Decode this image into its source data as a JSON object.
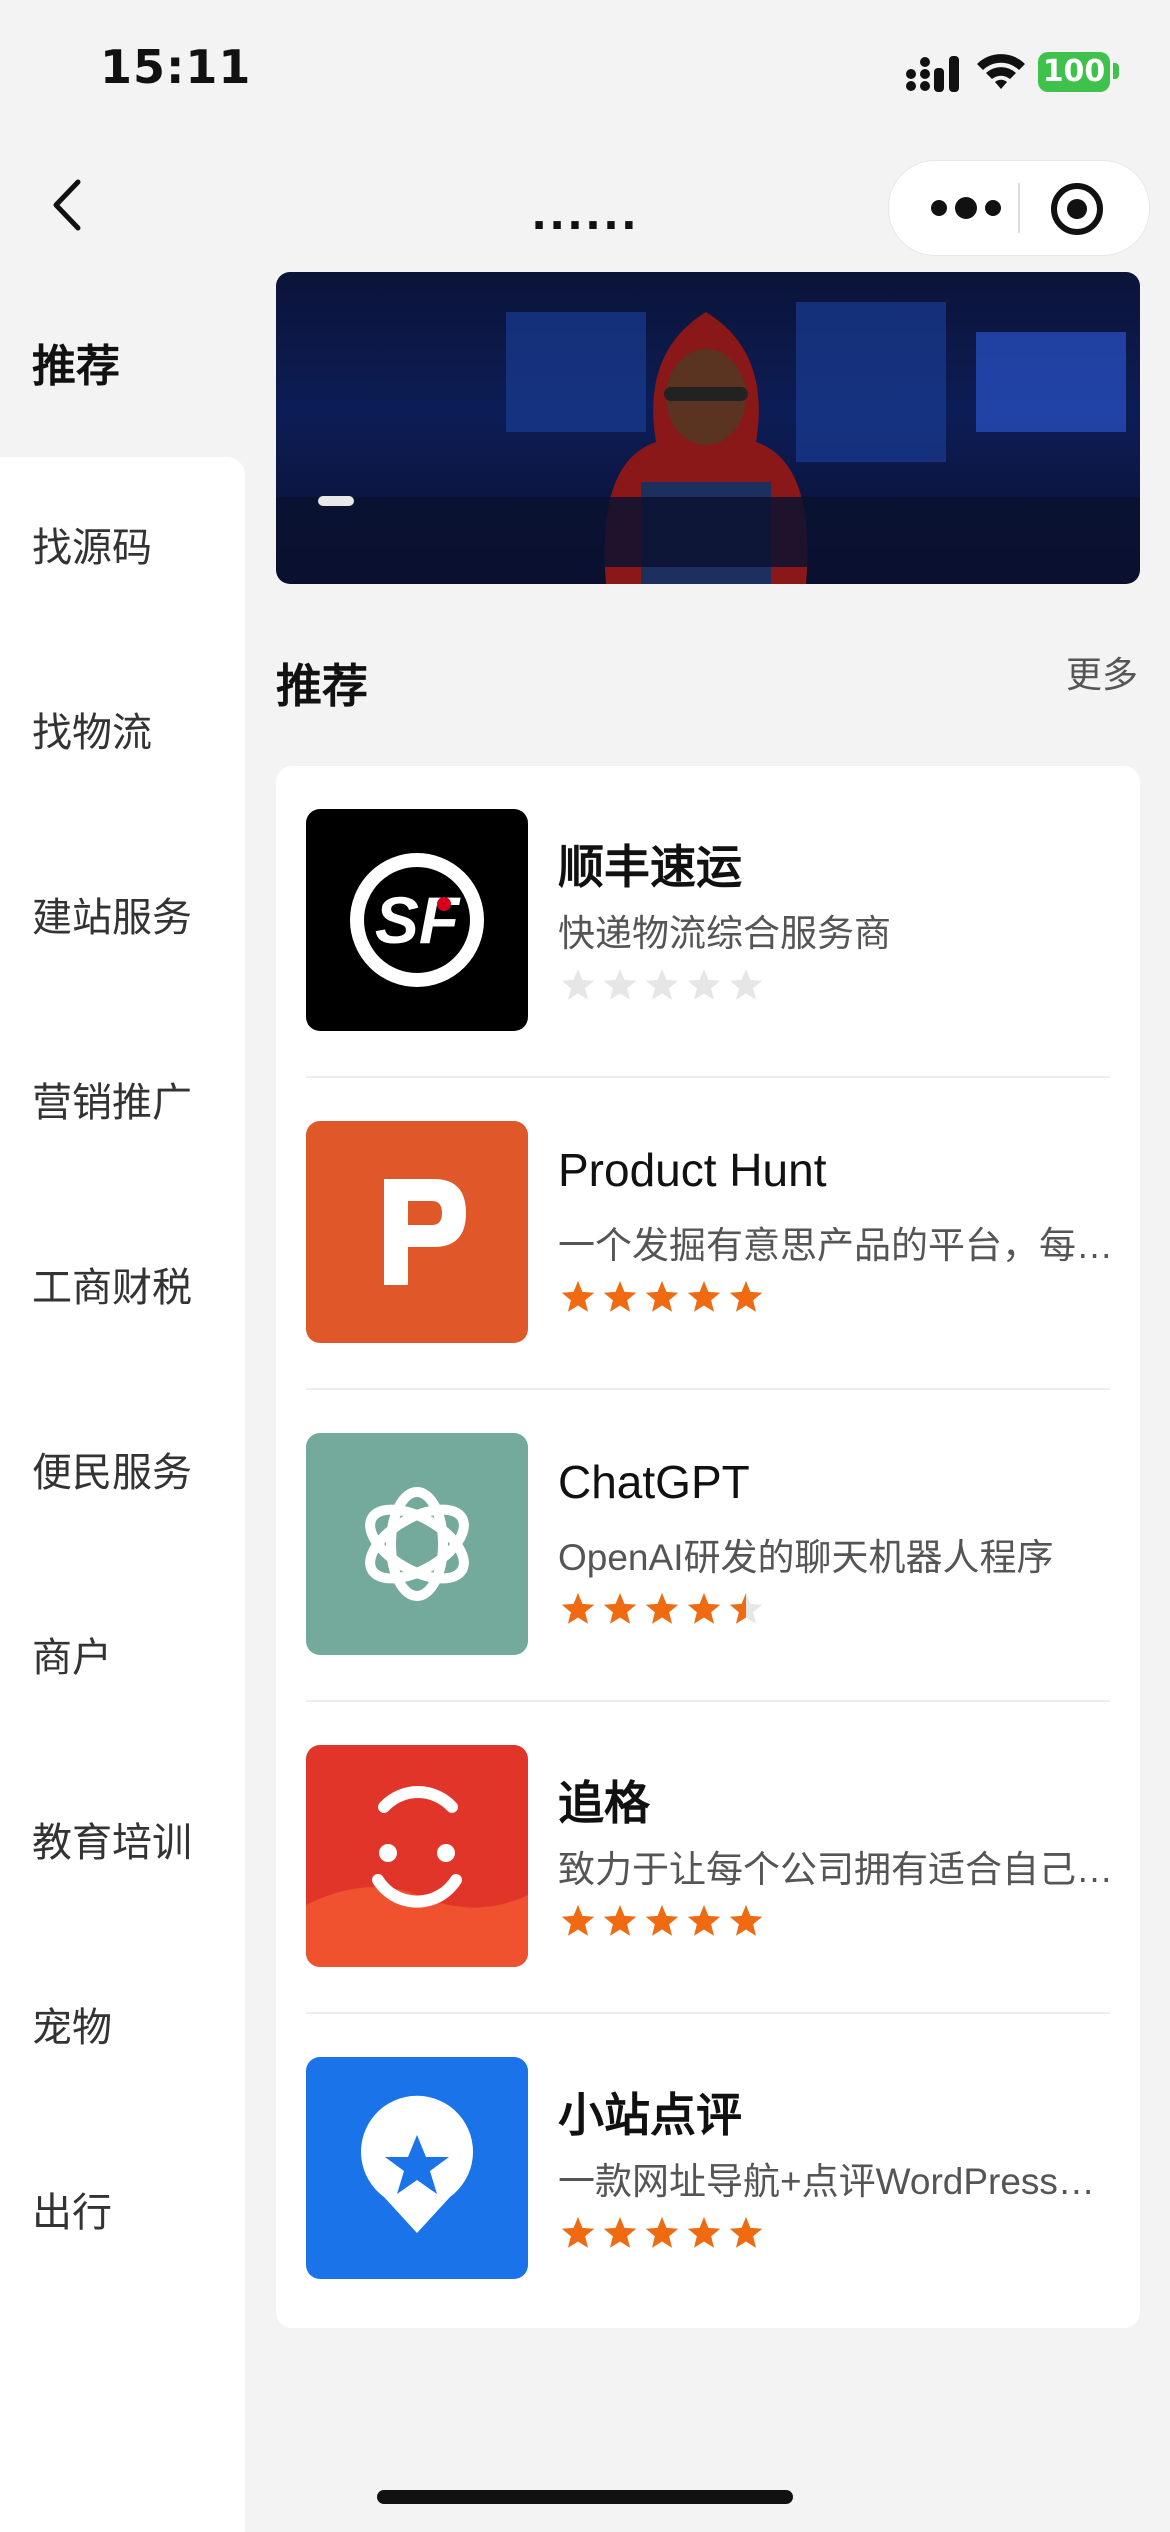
{
  "status_bar": {
    "time": "15:11",
    "battery": "100"
  },
  "nav": {
    "title": "......"
  },
  "sidebar": {
    "items": [
      {
        "label": "推荐",
        "active": true
      },
      {
        "label": "找源码"
      },
      {
        "label": "找物流"
      },
      {
        "label": "建站服务"
      },
      {
        "label": "营销推广"
      },
      {
        "label": "工商财税"
      },
      {
        "label": "便民服务"
      },
      {
        "label": "商户"
      },
      {
        "label": "教育培训"
      },
      {
        "label": "宠物"
      },
      {
        "label": "出行"
      }
    ]
  },
  "section": {
    "title": "推荐",
    "more": "更多"
  },
  "apps": [
    {
      "name": "顺丰速运",
      "desc": "快递物流综合服务商",
      "rating": 0,
      "icon": "sf-express-logo",
      "icon_bg": "#000000"
    },
    {
      "name": "Product Hunt",
      "desc": "一个发掘有意思产品的平台，每天都会推荐新产品",
      "rating": 5,
      "icon": "letter-p-logo",
      "icon_bg": "#e0582a"
    },
    {
      "name": "ChatGPT",
      "desc": "OpenAI研发的聊天机器人程序",
      "rating": 4.5,
      "icon": "openai-knot-logo",
      "icon_bg": "#74aa9c"
    },
    {
      "name": "追格",
      "desc": "致力于让每个公司拥有适合自己的小程序",
      "rating": 5,
      "icon": "smile-face-logo",
      "icon_bg": "#e1352a"
    },
    {
      "name": "小站点评",
      "desc": "一款网址导航+点评WordPress主题",
      "rating": 5,
      "icon": "location-star-pin-logo",
      "icon_bg": "#1a73e8"
    }
  ],
  "colors": {
    "star": "#f06a12",
    "star_empty": "#e6e6e6",
    "battery": "#3ec24b"
  }
}
